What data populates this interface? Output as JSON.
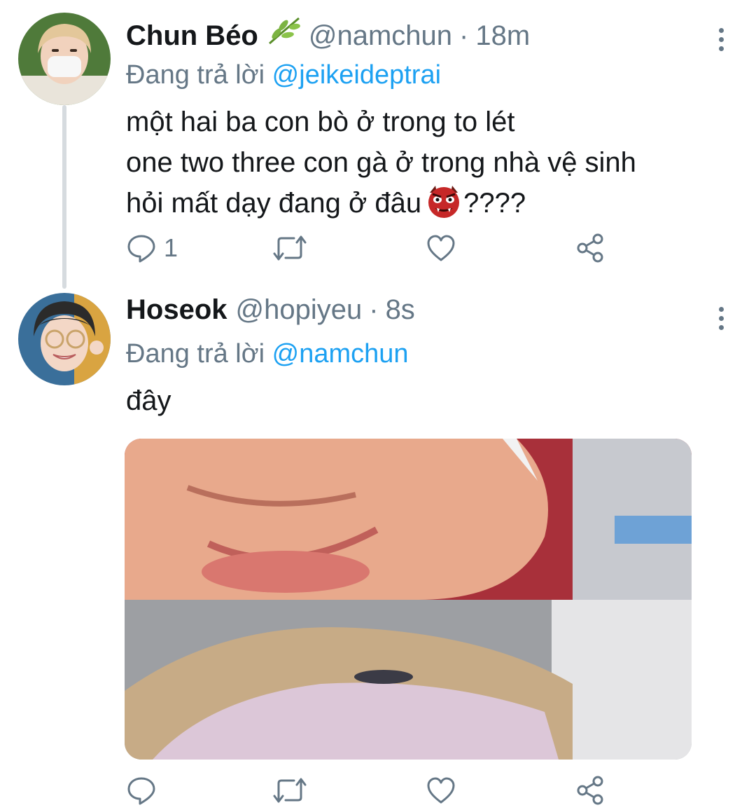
{
  "tweets": [
    {
      "display_name": "Chun Béo",
      "handle": "@namchun",
      "separator": "·",
      "time": "18m",
      "reply_prefix": "Đang trả lời",
      "reply_mention": "@jeikeideptrai",
      "text_lines": [
        "một hai ba con bò ở trong to lét",
        "one two three con gà ở trong nhà vệ sinh",
        "hỏi mất dạy đang ở đâu"
      ],
      "text_suffix": "????",
      "emoji": "ogre-emoji",
      "reply_count": "1",
      "icons": [
        "reply-icon",
        "retweet-icon",
        "like-icon",
        "share-icon",
        "more-options-icon",
        "leaf-emoji"
      ]
    },
    {
      "display_name": "Hoseok",
      "handle": "@hopiyeu",
      "separator": "·",
      "time": "8s",
      "reply_prefix": "Đang trả lời",
      "reply_mention": "@namchun",
      "text": "đây",
      "media": "photo-meme-collage",
      "icons": [
        "reply-icon",
        "retweet-icon",
        "like-icon",
        "share-icon",
        "more-options-icon"
      ]
    }
  ],
  "colors": {
    "text": "#14171a",
    "secondary": "#657786",
    "link": "#1da1f2",
    "thread_line": "#d6dbdf"
  }
}
